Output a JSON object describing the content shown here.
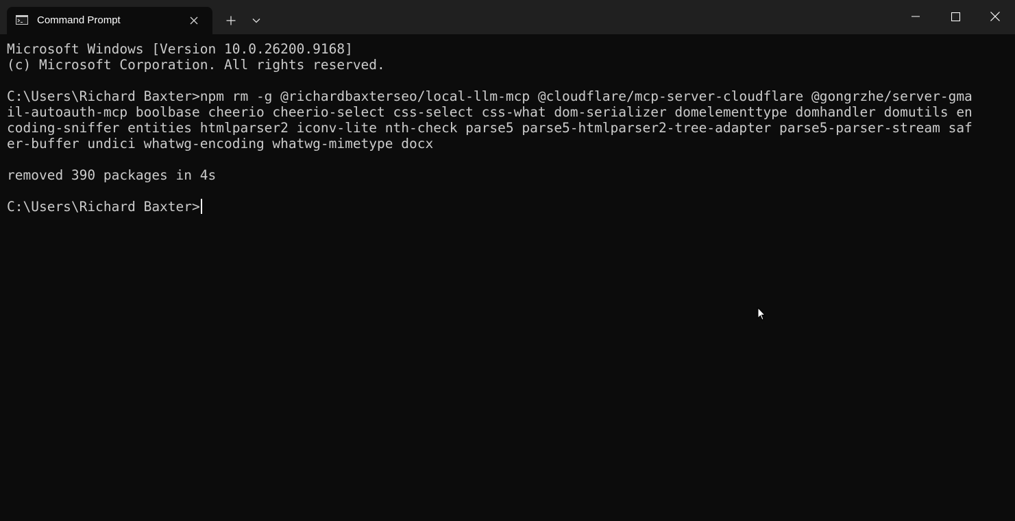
{
  "tab": {
    "title": "Command Prompt",
    "icon": "command-prompt-icon"
  },
  "titlebar": {
    "new_tab_icon": "plus-icon",
    "dropdown_icon": "chevron-down-icon",
    "minimize_icon": "minimize-icon",
    "maximize_icon": "maximize-icon",
    "close_icon": "close-icon"
  },
  "terminal": {
    "lines": [
      "Microsoft Windows [Version 10.0.26200.9168]",
      "(c) Microsoft Corporation. All rights reserved.",
      "",
      "C:\\Users\\Richard Baxter>npm rm -g @richardbaxterseo/local-llm-mcp @cloudflare/mcp-server-cloudflare @gongrzhe/server-gma",
      "il-autoauth-mcp boolbase cheerio cheerio-select css-select css-what dom-serializer domelementtype domhandler domutils en",
      "coding-sniffer entities htmlparser2 iconv-lite nth-check parse5 parse5-htmlparser2-tree-adapter parse5-parser-stream saf",
      "er-buffer undici whatwg-encoding whatwg-mimetype docx",
      "",
      "removed 390 packages in 4s",
      "",
      "C:\\Users\\Richard Baxter>"
    ]
  },
  "colors": {
    "background": "#0c0c0c",
    "titlebar": "#202020",
    "text": "#cccccc"
  }
}
